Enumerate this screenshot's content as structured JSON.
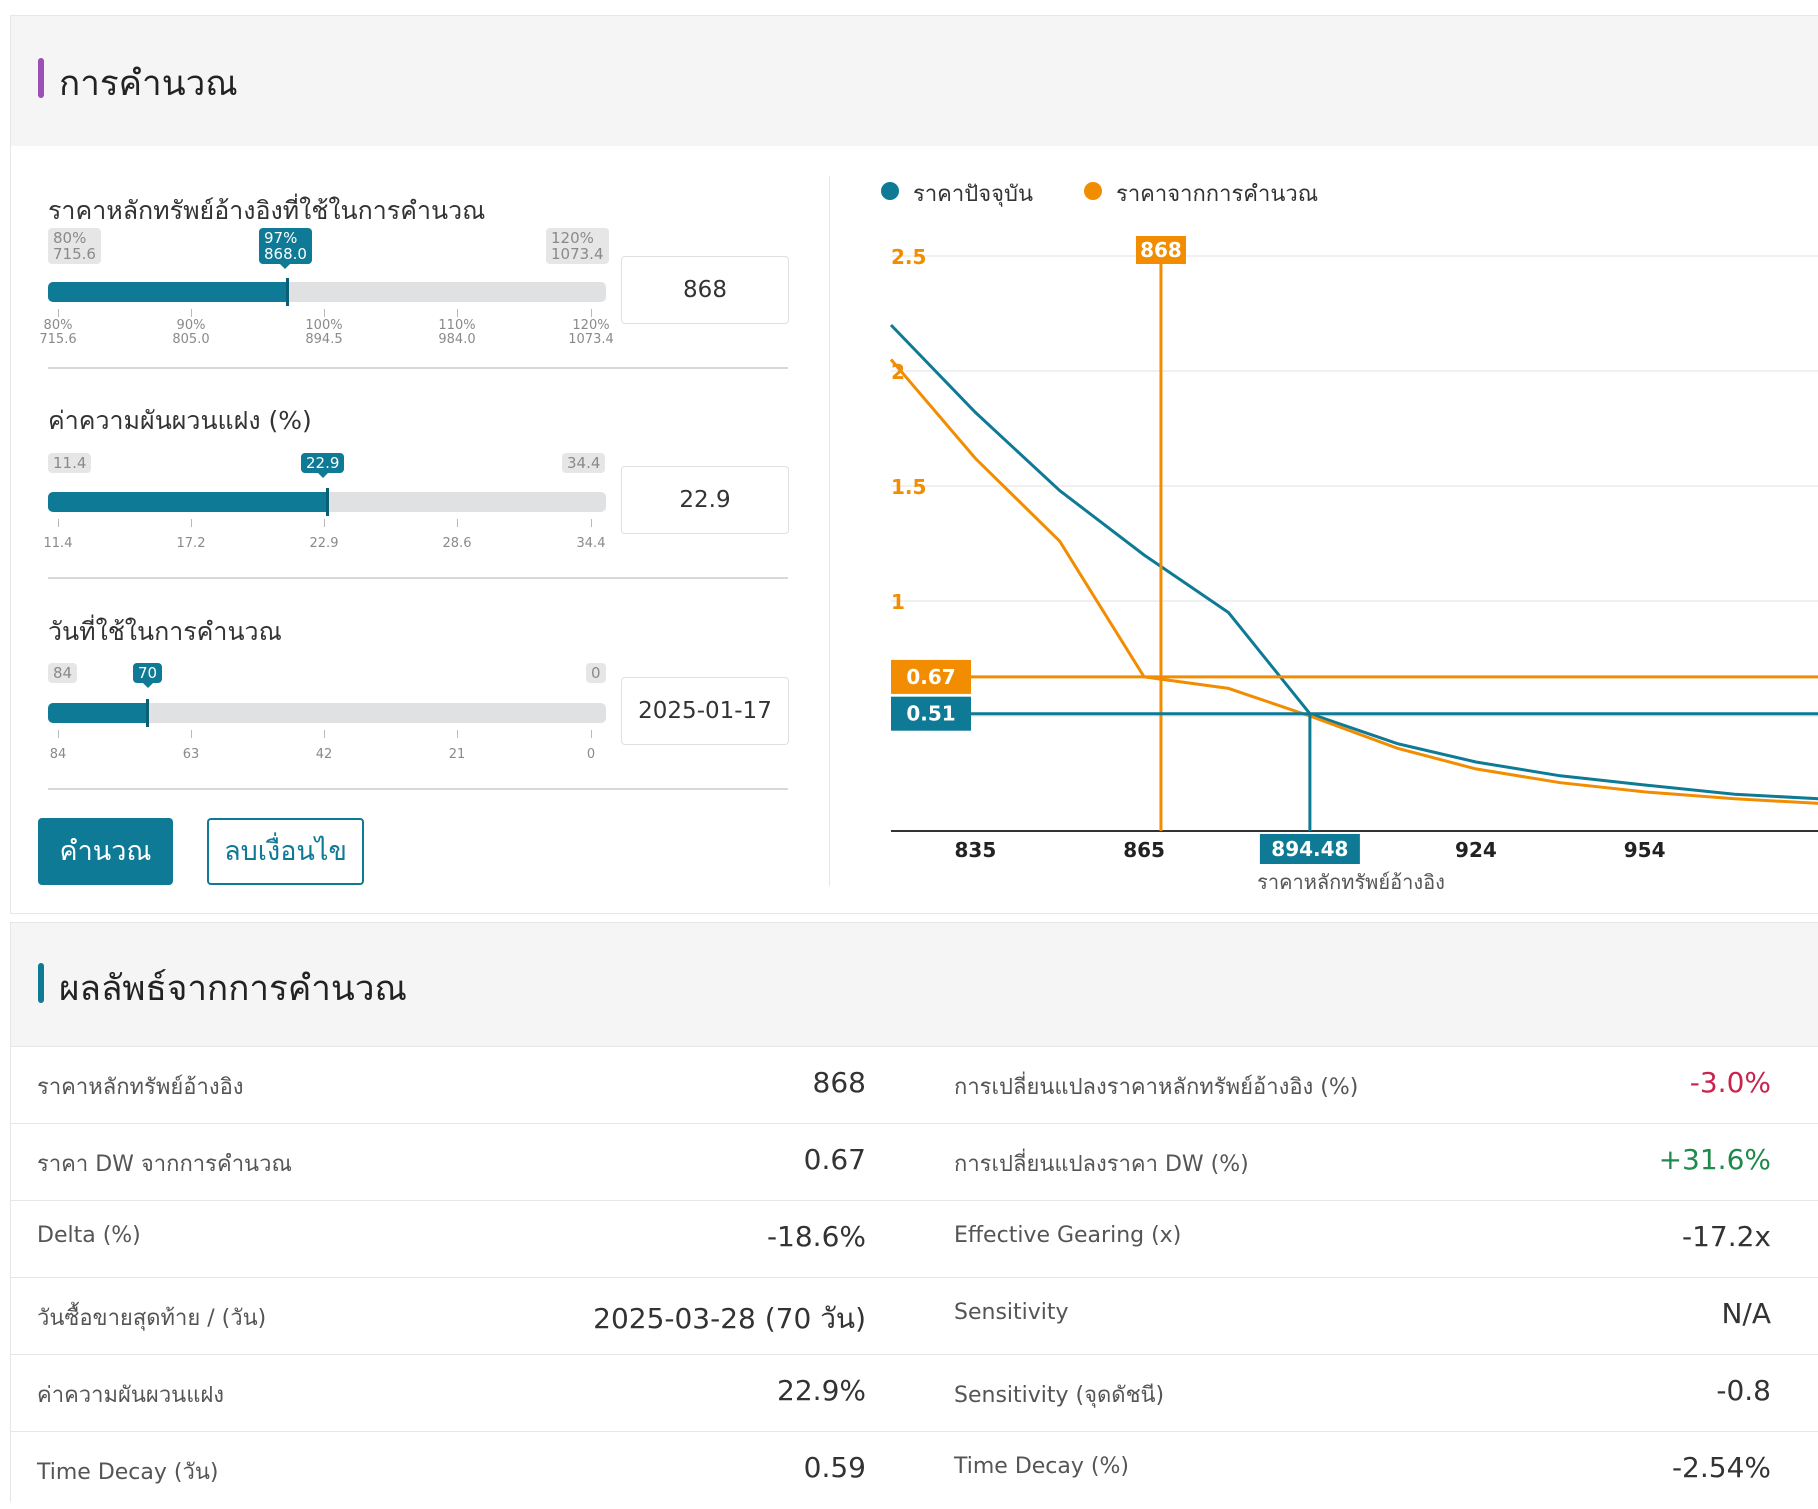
{
  "calc": {
    "title": "การคำนวณ",
    "title_bar_color": "#9c4fb6",
    "sliders": [
      {
        "title": "ราคาหลักทรัพย์อ้างอิงที่ใช้ในการคำนวณ",
        "min_tag": "80%\n715.6",
        "max_tag": "120%\n1073.4",
        "current_tag": "97%\n868.0",
        "fill_fraction": 0.425,
        "value": "868",
        "ticks": [
          "80%\n715.6",
          "90%\n805.0",
          "100%\n894.5",
          "110%\n984.0",
          "120%\n1073.4"
        ]
      },
      {
        "title": "ค่าความผันผวนแฝง (%)",
        "min_tag": "11.4",
        "max_tag": "34.4",
        "current_tag": "22.9",
        "fill_fraction": 0.5,
        "value": "22.9",
        "ticks": [
          "11.4",
          "17.2",
          "22.9",
          "28.6",
          "34.4"
        ]
      },
      {
        "title": "วันที่ใช้ในการคำนวณ",
        "min_tag": "84",
        "max_tag": "0",
        "current_tag": "70",
        "fill_fraction": 0.18,
        "value": "2025-01-17",
        "ticks": [
          "84",
          "63",
          "42",
          "21",
          "0"
        ]
      }
    ],
    "buttons": {
      "calculate": "คำนวณ",
      "reset": "ลบเงื่อนไข"
    }
  },
  "chart_data": {
    "type": "line",
    "series": [
      {
        "name": "ราคาปัจจุบัน",
        "color": "#0e7a95",
        "x": [
          820,
          835,
          850,
          865,
          880,
          894.48,
          910,
          924,
          939,
          954,
          970,
          985
        ],
        "y": [
          2.2,
          1.82,
          1.48,
          1.2,
          0.95,
          0.51,
          0.38,
          0.3,
          0.24,
          0.2,
          0.16,
          0.14
        ]
      },
      {
        "name": "ราคาจากการคำนวณ",
        "color": "#f28c00",
        "x": [
          820,
          835,
          850,
          865,
          880,
          894.48,
          910,
          924,
          939,
          954,
          970,
          985
        ],
        "y": [
          2.05,
          1.62,
          1.26,
          0.67,
          0.62,
          0.5,
          0.36,
          0.27,
          0.21,
          0.17,
          0.14,
          0.12
        ]
      }
    ],
    "xticks": [
      "835",
      "865",
      "924",
      "954"
    ],
    "xtick_values": [
      835,
      865,
      924,
      954
    ],
    "yticks": [
      "2.5",
      "2",
      "1.5",
      "1",
      "0.5"
    ],
    "ytick_values": [
      2.5,
      2,
      1.5,
      1,
      0.5
    ],
    "xlim": [
      820,
      985
    ],
    "ylim": [
      0,
      2.5
    ],
    "xlabel": "ราคาหลักทรัพย์อ้างอิง",
    "markers": {
      "v_orange": {
        "x": 868,
        "label": "868"
      },
      "v_blue": {
        "x": 894.48,
        "label": "894.48"
      },
      "h_orange": {
        "y": 0.67,
        "label": "0.67"
      },
      "h_blue": {
        "y": 0.51,
        "label": "0.51"
      }
    }
  },
  "results": {
    "title": "ผลลัพธ์จากการคำนวณ",
    "title_bar_color": "#0e7a95",
    "rows": [
      {
        "l_label": "ราคาหลักทรัพย์อ้างอิง",
        "l_value": "868",
        "r_label": "การเปลี่ยนแปลงราคาหลักทรัพย์อ้างอิง (%)",
        "r_value": "-3.0%",
        "r_color": "#c7254e"
      },
      {
        "l_label": "ราคา DW จากการคำนวณ",
        "l_value": "0.67",
        "r_label": "การเปลี่ยนแปลงราคา DW (%)",
        "r_value": "+31.6%",
        "r_color": "#1e8a4c"
      },
      {
        "l_label": "Delta (%)",
        "l_value": "-18.6%",
        "r_label": "Effective Gearing (x)",
        "r_value": "-17.2x",
        "r_color": "#333333"
      },
      {
        "l_label": "วันซื้อขายสุดท้าย / (วัน)",
        "l_value": "2025-03-28 (70 วัน)",
        "r_label": "Sensitivity",
        "r_value": "N/A",
        "r_color": "#333333"
      },
      {
        "l_label": "ค่าความผันผวนแฝง",
        "l_value": "22.9%",
        "r_label": "Sensitivity (จุดดัชนี)",
        "r_value": "-0.8",
        "r_color": "#333333"
      },
      {
        "l_label": "Time Decay (วัน)",
        "l_value": "0.59",
        "r_label": "Time Decay (%)",
        "r_value": "-2.54%",
        "r_color": "#333333"
      }
    ]
  }
}
